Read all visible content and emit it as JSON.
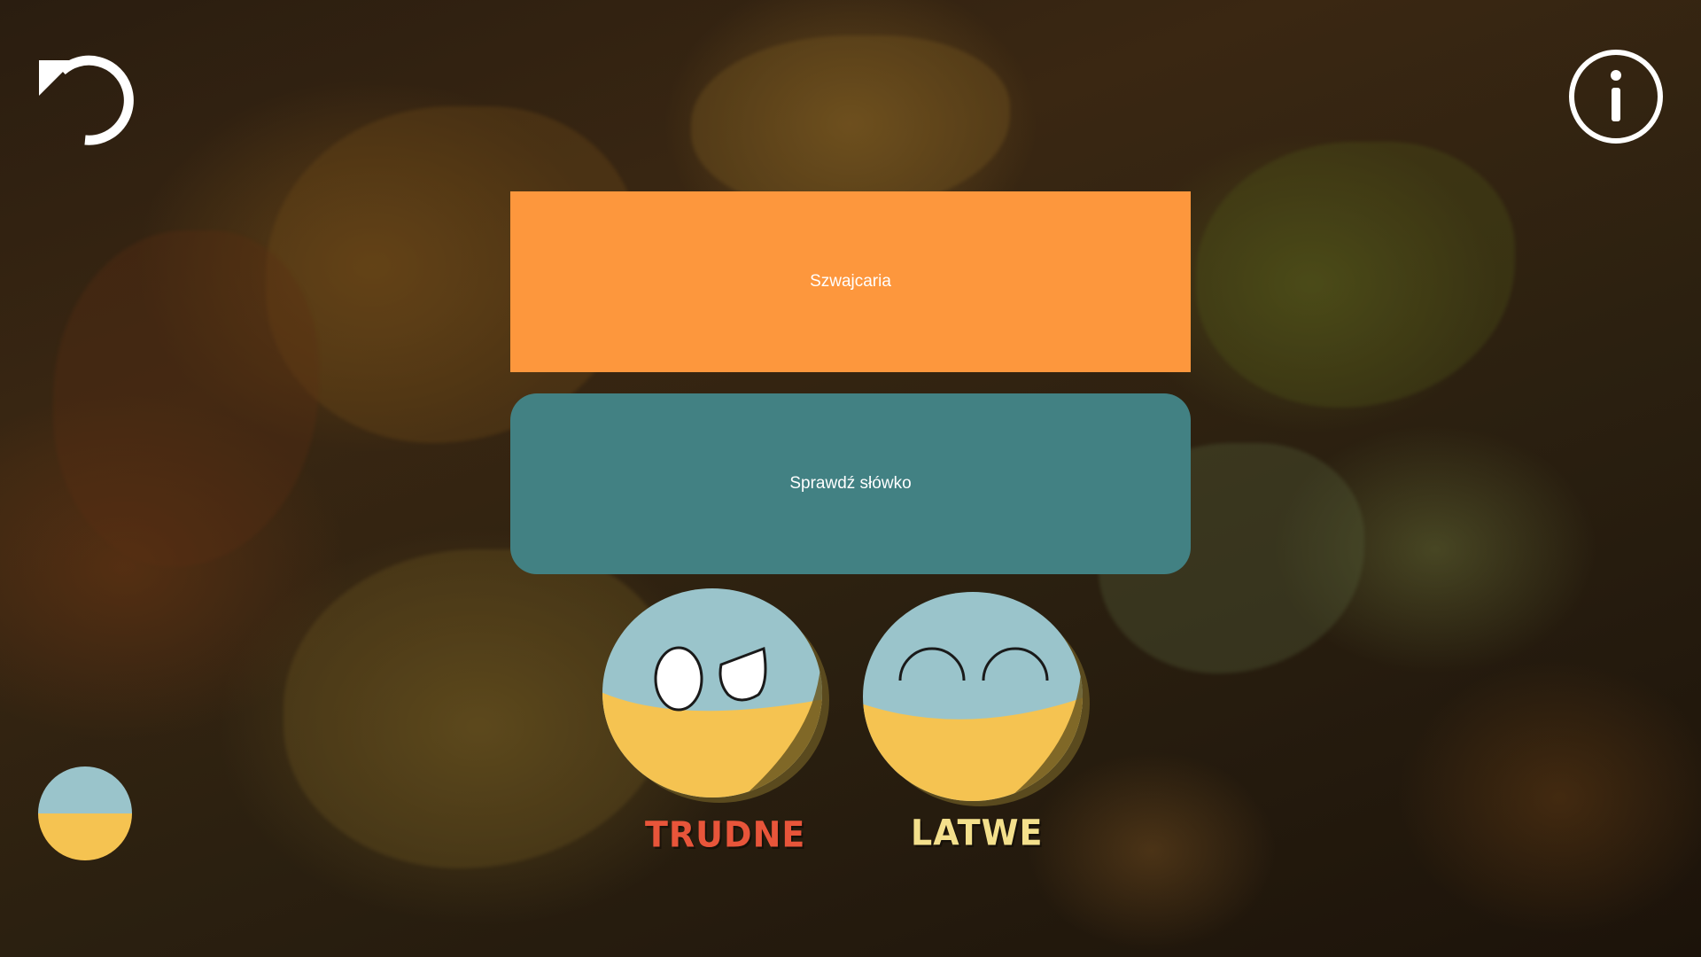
{
  "word_card": {
    "text": "Szwajcaria"
  },
  "check_button": {
    "label": "Sprawdź słówko"
  },
  "difficulty": {
    "hard_label": "TRUDNE",
    "easy_label": "LATWE"
  },
  "icons": {
    "undo": "undo-icon",
    "info": "info-icon",
    "ball": "flag-ball-icon"
  },
  "colors": {
    "word_card": "#fd973d",
    "check_button": "#428183",
    "hard_label": "#e8553a",
    "easy_label": "#f4e08c",
    "ball_top": "#9ac4cb",
    "ball_bottom": "#f5c351"
  }
}
